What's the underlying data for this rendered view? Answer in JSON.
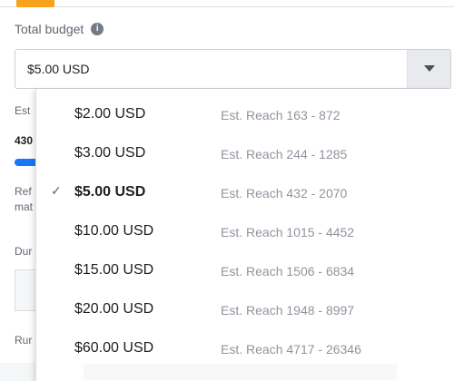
{
  "budget": {
    "label": "Total budget",
    "value": "$5.00 USD"
  },
  "background_text": {
    "row1": "Est",
    "row2": "430",
    "row3": "Ref",
    "row4": "mat",
    "row5": "Dur",
    "row6": "Rur"
  },
  "dropdown": {
    "options": [
      {
        "amount": "$2.00 USD",
        "reach": "Est. Reach 163 - 872"
      },
      {
        "amount": "$3.00 USD",
        "reach": "Est. Reach 244 - 1285"
      },
      {
        "amount": "$5.00 USD",
        "reach": "Est. Reach 432 - 2070"
      },
      {
        "amount": "$10.00 USD",
        "reach": "Est. Reach 1015 - 4452"
      },
      {
        "amount": "$15.00 USD",
        "reach": "Est. Reach 1506 - 6834"
      },
      {
        "amount": "$20.00 USD",
        "reach": "Est. Reach 1948 - 8997"
      },
      {
        "amount": "$60.00 USD",
        "reach": "Est. Reach 4717 - 26346"
      }
    ],
    "selected_check": "✓"
  },
  "colors": {
    "accent": "#f7a21b",
    "progress": "#1877f2",
    "border": "#dddfe2",
    "text": "#1c1e21",
    "muted": "#606770"
  },
  "icons": {
    "info": "info-icon",
    "dropdown": "chevron-down-icon",
    "check": "check-icon"
  }
}
